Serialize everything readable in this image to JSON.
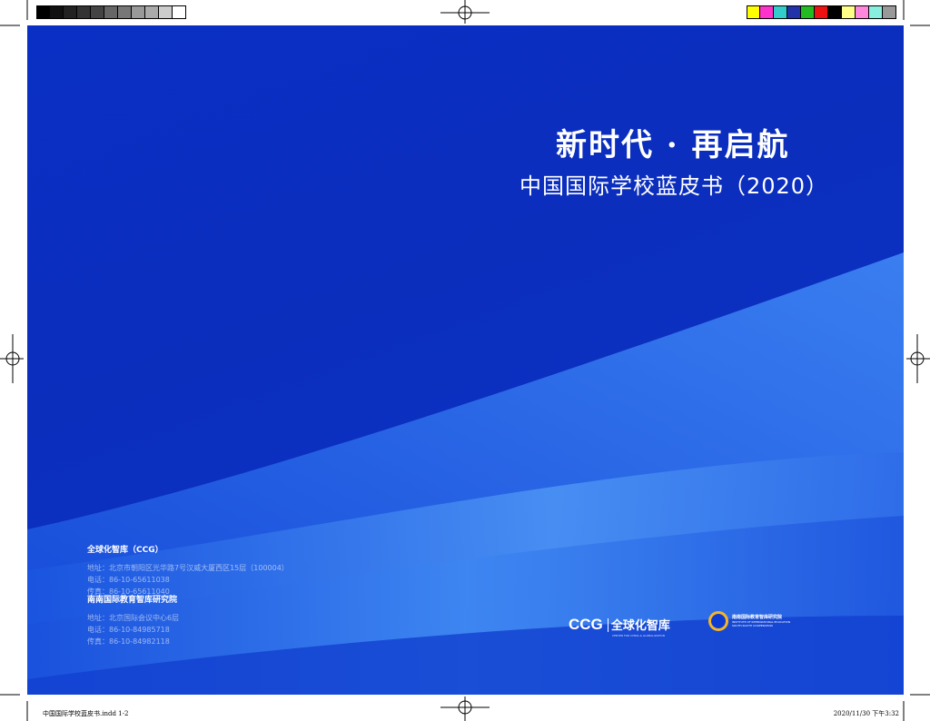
{
  "gray_bar": [
    "#000000",
    "#111111",
    "#222222",
    "#333333",
    "#444444",
    "#666666",
    "#777777",
    "#999999",
    "#aaaaaa",
    "#cccccc",
    "#ffffff"
  ],
  "color_bar": [
    "#ffff00",
    "#ff33cc",
    "#33cccc",
    "#2233aa",
    "#22bb22",
    "#ee1111",
    "#000000",
    "#ffff88",
    "#ff88dd",
    "#88eedd",
    "#999999"
  ],
  "cover": {
    "title": "新时代 · 再启航",
    "subtitle": "中国国际学校蓝皮书（2020）",
    "org1": {
      "name": "全球化智库（CCG）",
      "address": "地址：北京市朝阳区光华路7号汉威大厦西区15层（100004）",
      "phone": "电话：86-10-65611038",
      "fax": "传真：86-10-65611040"
    },
    "org2": {
      "name": "南南国际教育智库研究院",
      "address": "地址：北京国际会议中心6层",
      "phone": "电话：86-10-84985718",
      "fax": "传真：86-10-84982118"
    },
    "logo1": {
      "mark": "CCG",
      "name": "全球化智库",
      "tagline": "CENTER FOR CHINA & GLOBALIZATION"
    },
    "logo2": {
      "name": "南南国际教育智库研究院",
      "en1": "INSTITUTE OF INTERNATIONAL EDUCATION",
      "en2": "SOUTH-SOUTH COOPERATION"
    }
  },
  "footer": {
    "file": "中国国际学校蓝皮书.indd 1-2",
    "date": "2020/11/30 下午3:32"
  }
}
